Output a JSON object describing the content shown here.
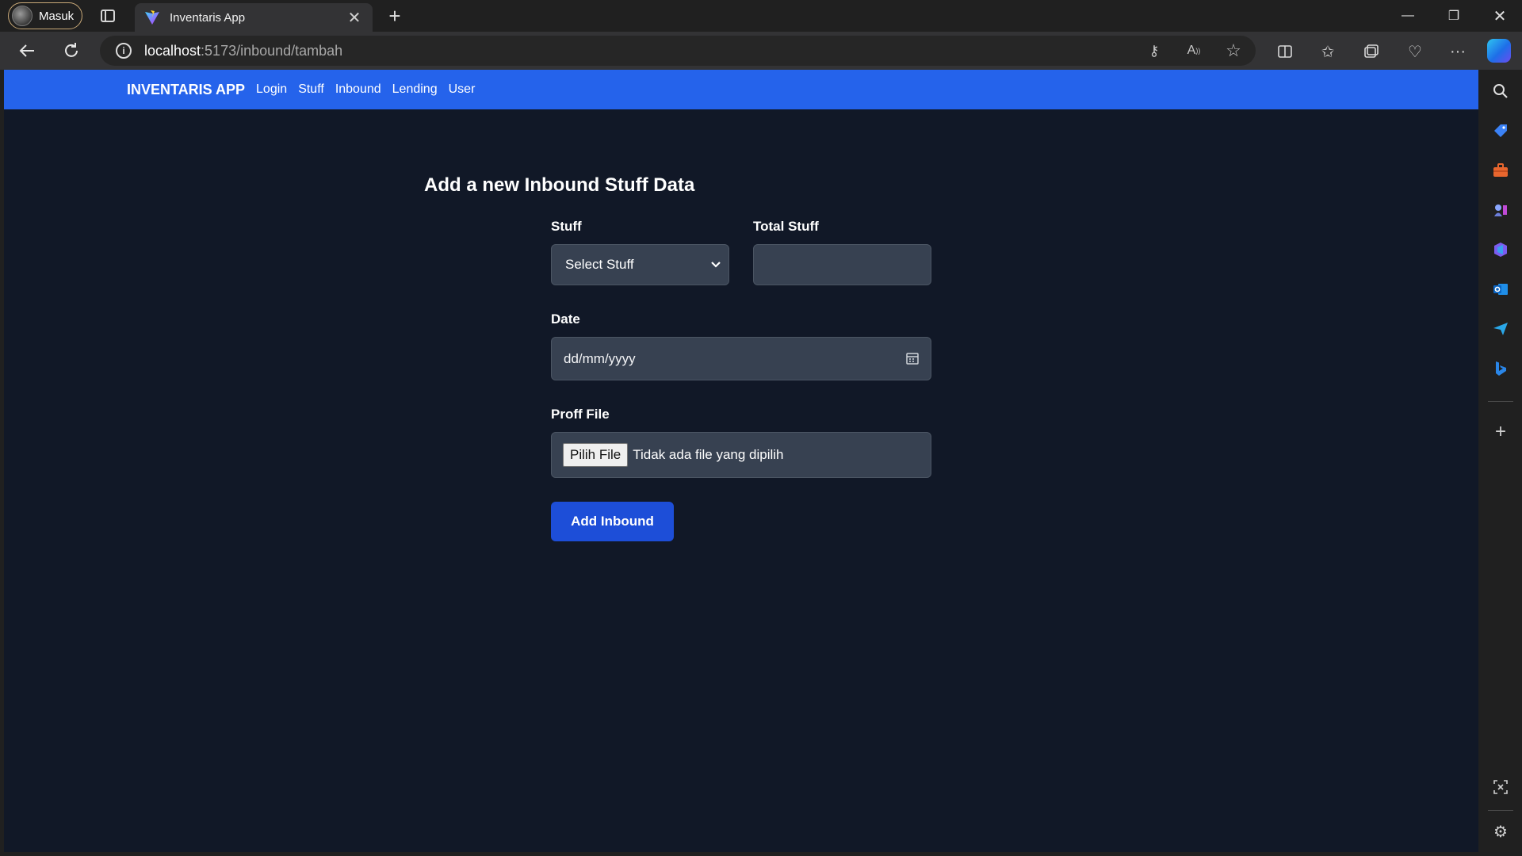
{
  "browser": {
    "profile_name": "Masuk",
    "tab_title": "Inventaris App",
    "url_host": "localhost",
    "url_path": ":5173/inbound/tambah"
  },
  "app": {
    "brand": "INVENTARIS APP",
    "nav": [
      "Login",
      "Stuff",
      "Inbound",
      "Lending",
      "User"
    ],
    "colors": {
      "navbar": "#2563eb",
      "background": "#111827",
      "button": "#1d4ed8",
      "input": "#374151"
    }
  },
  "form": {
    "title": "Add a new Inbound Stuff Data",
    "stuff_label": "Stuff",
    "stuff_selected": "Select Stuff",
    "total_label": "Total Stuff",
    "total_value": "",
    "date_label": "Date",
    "date_placeholder": "dd/mm/yyyy",
    "file_label": "Proff File",
    "file_button": "Pilih File",
    "file_status": "Tidak ada file yang dipilih",
    "submit": "Add Inbound"
  }
}
